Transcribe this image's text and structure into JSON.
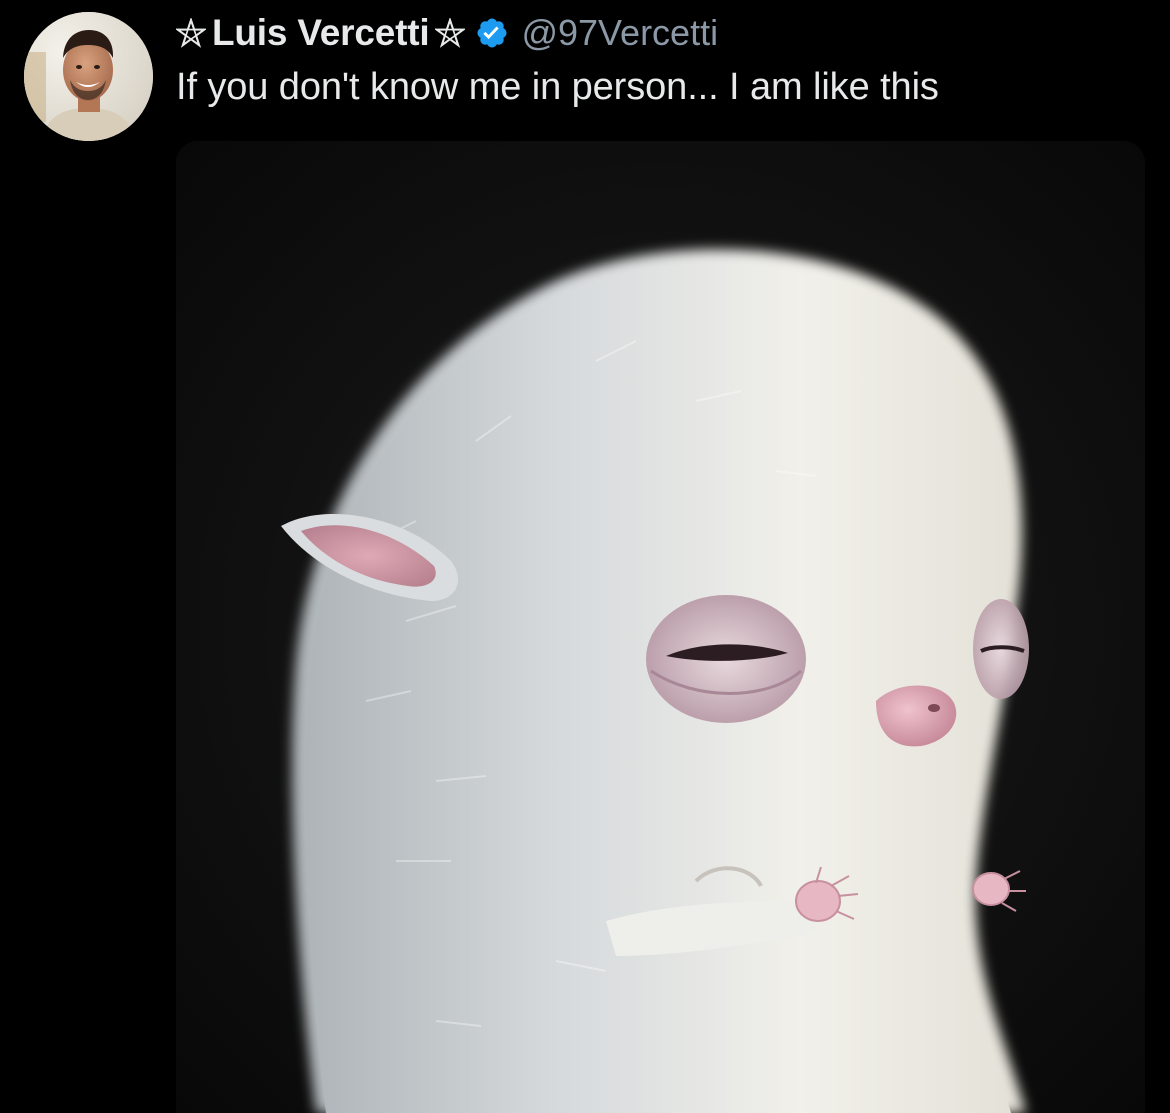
{
  "tweet": {
    "author": {
      "display_name": "Luis Vercetti",
      "name_prefix_glyph": "pentagram-icon",
      "name_suffix_glyph": "pentagram-icon",
      "verified": true,
      "verified_color": "#1d9bf0",
      "handle": "@97Vercetti",
      "avatar_icon": "avatar-photo-icon"
    },
    "text": "If you don't know me in person... I am like this",
    "media": {
      "kind": "image",
      "icon": "white-furry-creature-painting-icon"
    }
  },
  "colors": {
    "background": "#000000",
    "primary_text": "#e7e9ea",
    "secondary_text": "#8b98a5",
    "verified_blue": "#1d9bf0"
  }
}
